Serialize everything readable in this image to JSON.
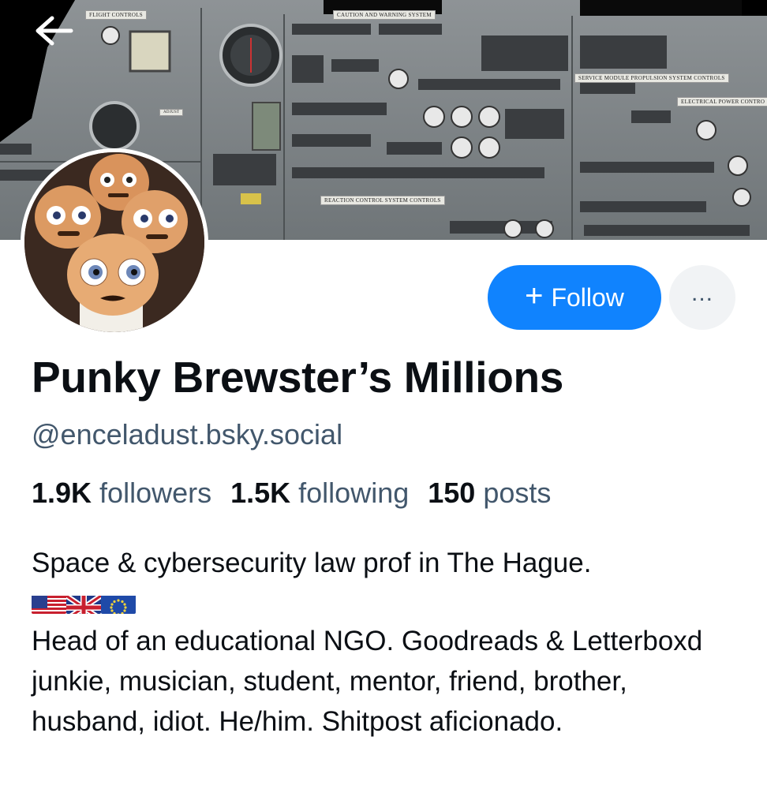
{
  "banner": {
    "labels": {
      "flight_controls": "FLIGHT CONTROLS",
      "caution": "CAUTION AND WARNING SYSTEM",
      "propulsion": "SERVICE MODULE PROPULSION SYSTEM CONTROLS",
      "electrical": "ELECTRICAL POWER CONTRO",
      "reaction": "REACTION CONTROL SYSTEM CONTROLS",
      "adjust": "ADJUST"
    }
  },
  "actions": {
    "follow_plus": "+",
    "follow_label": "Follow",
    "more_label": "..."
  },
  "profile": {
    "display_name": "Punky Brewster’s Millions",
    "handle": "@enceladust.bsky.social",
    "stats": {
      "followers_count": "1.9K",
      "followers_label": "followers",
      "following_count": "1.5K",
      "following_label": "following",
      "posts_count": "150",
      "posts_label": "posts"
    },
    "bio": {
      "line1": "Space & cybersecurity law prof in The Hague.",
      "flags": [
        "us-flag",
        "uk-flag",
        "eu-flag"
      ],
      "line2": "Head of an educational NGO. Goodreads & Letterboxd junkie, musician, student, mentor, friend, brother, husband, idiot. He/him. Shitpost aficionado."
    }
  },
  "colors": {
    "accent": "#1083fe",
    "text_primary": "#0b0f14",
    "text_secondary": "#42576c",
    "more_button_bg": "#f1f3f5"
  },
  "icons": {
    "back": "arrow-left-icon",
    "more": "ellipsis-icon"
  }
}
